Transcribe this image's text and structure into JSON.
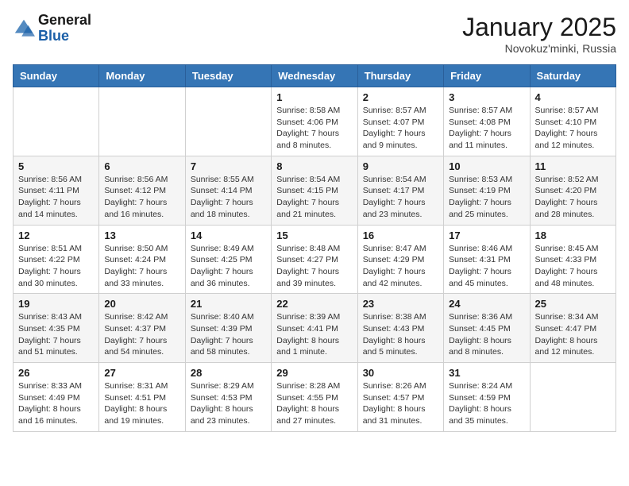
{
  "logo": {
    "general": "General",
    "blue": "Blue"
  },
  "header": {
    "month": "January 2025",
    "location": "Novokuz'minki, Russia"
  },
  "weekdays": [
    "Sunday",
    "Monday",
    "Tuesday",
    "Wednesday",
    "Thursday",
    "Friday",
    "Saturday"
  ],
  "weeks": [
    [
      {
        "day": "",
        "info": ""
      },
      {
        "day": "",
        "info": ""
      },
      {
        "day": "",
        "info": ""
      },
      {
        "day": "1",
        "info": "Sunrise: 8:58 AM\nSunset: 4:06 PM\nDaylight: 7 hours\nand 8 minutes."
      },
      {
        "day": "2",
        "info": "Sunrise: 8:57 AM\nSunset: 4:07 PM\nDaylight: 7 hours\nand 9 minutes."
      },
      {
        "day": "3",
        "info": "Sunrise: 8:57 AM\nSunset: 4:08 PM\nDaylight: 7 hours\nand 11 minutes."
      },
      {
        "day": "4",
        "info": "Sunrise: 8:57 AM\nSunset: 4:10 PM\nDaylight: 7 hours\nand 12 minutes."
      }
    ],
    [
      {
        "day": "5",
        "info": "Sunrise: 8:56 AM\nSunset: 4:11 PM\nDaylight: 7 hours\nand 14 minutes."
      },
      {
        "day": "6",
        "info": "Sunrise: 8:56 AM\nSunset: 4:12 PM\nDaylight: 7 hours\nand 16 minutes."
      },
      {
        "day": "7",
        "info": "Sunrise: 8:55 AM\nSunset: 4:14 PM\nDaylight: 7 hours\nand 18 minutes."
      },
      {
        "day": "8",
        "info": "Sunrise: 8:54 AM\nSunset: 4:15 PM\nDaylight: 7 hours\nand 21 minutes."
      },
      {
        "day": "9",
        "info": "Sunrise: 8:54 AM\nSunset: 4:17 PM\nDaylight: 7 hours\nand 23 minutes."
      },
      {
        "day": "10",
        "info": "Sunrise: 8:53 AM\nSunset: 4:19 PM\nDaylight: 7 hours\nand 25 minutes."
      },
      {
        "day": "11",
        "info": "Sunrise: 8:52 AM\nSunset: 4:20 PM\nDaylight: 7 hours\nand 28 minutes."
      }
    ],
    [
      {
        "day": "12",
        "info": "Sunrise: 8:51 AM\nSunset: 4:22 PM\nDaylight: 7 hours\nand 30 minutes."
      },
      {
        "day": "13",
        "info": "Sunrise: 8:50 AM\nSunset: 4:24 PM\nDaylight: 7 hours\nand 33 minutes."
      },
      {
        "day": "14",
        "info": "Sunrise: 8:49 AM\nSunset: 4:25 PM\nDaylight: 7 hours\nand 36 minutes."
      },
      {
        "day": "15",
        "info": "Sunrise: 8:48 AM\nSunset: 4:27 PM\nDaylight: 7 hours\nand 39 minutes."
      },
      {
        "day": "16",
        "info": "Sunrise: 8:47 AM\nSunset: 4:29 PM\nDaylight: 7 hours\nand 42 minutes."
      },
      {
        "day": "17",
        "info": "Sunrise: 8:46 AM\nSunset: 4:31 PM\nDaylight: 7 hours\nand 45 minutes."
      },
      {
        "day": "18",
        "info": "Sunrise: 8:45 AM\nSunset: 4:33 PM\nDaylight: 7 hours\nand 48 minutes."
      }
    ],
    [
      {
        "day": "19",
        "info": "Sunrise: 8:43 AM\nSunset: 4:35 PM\nDaylight: 7 hours\nand 51 minutes."
      },
      {
        "day": "20",
        "info": "Sunrise: 8:42 AM\nSunset: 4:37 PM\nDaylight: 7 hours\nand 54 minutes."
      },
      {
        "day": "21",
        "info": "Sunrise: 8:40 AM\nSunset: 4:39 PM\nDaylight: 7 hours\nand 58 minutes."
      },
      {
        "day": "22",
        "info": "Sunrise: 8:39 AM\nSunset: 4:41 PM\nDaylight: 8 hours\nand 1 minute."
      },
      {
        "day": "23",
        "info": "Sunrise: 8:38 AM\nSunset: 4:43 PM\nDaylight: 8 hours\nand 5 minutes."
      },
      {
        "day": "24",
        "info": "Sunrise: 8:36 AM\nSunset: 4:45 PM\nDaylight: 8 hours\nand 8 minutes."
      },
      {
        "day": "25",
        "info": "Sunrise: 8:34 AM\nSunset: 4:47 PM\nDaylight: 8 hours\nand 12 minutes."
      }
    ],
    [
      {
        "day": "26",
        "info": "Sunrise: 8:33 AM\nSunset: 4:49 PM\nDaylight: 8 hours\nand 16 minutes."
      },
      {
        "day": "27",
        "info": "Sunrise: 8:31 AM\nSunset: 4:51 PM\nDaylight: 8 hours\nand 19 minutes."
      },
      {
        "day": "28",
        "info": "Sunrise: 8:29 AM\nSunset: 4:53 PM\nDaylight: 8 hours\nand 23 minutes."
      },
      {
        "day": "29",
        "info": "Sunrise: 8:28 AM\nSunset: 4:55 PM\nDaylight: 8 hours\nand 27 minutes."
      },
      {
        "day": "30",
        "info": "Sunrise: 8:26 AM\nSunset: 4:57 PM\nDaylight: 8 hours\nand 31 minutes."
      },
      {
        "day": "31",
        "info": "Sunrise: 8:24 AM\nSunset: 4:59 PM\nDaylight: 8 hours\nand 35 minutes."
      },
      {
        "day": "",
        "info": ""
      }
    ]
  ]
}
